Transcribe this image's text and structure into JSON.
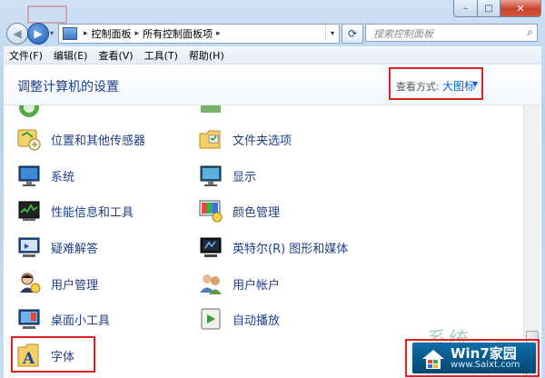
{
  "window": {
    "minimize_glyph": "–",
    "maximize_glyph": "□",
    "close_glyph": "✕"
  },
  "nav": {
    "back_glyph": "◀",
    "forward_glyph": "▶",
    "dropdown_glyph": "▾",
    "refresh_glyph": "⟳",
    "search_glyph": "⌕"
  },
  "address": {
    "sep_glyph": "▸",
    "crumbs": [
      "控制面板",
      "所有控制面板项"
    ]
  },
  "search": {
    "placeholder": "搜索控制面板"
  },
  "menu": [
    "文件(F)",
    "编辑(E)",
    "查看(V)",
    "工具(T)",
    "帮助(H)"
  ],
  "header": {
    "title": "调整计算机的设置",
    "view_by_label": "查看方式:",
    "view_by_value": "大图标",
    "caret": "▼"
  },
  "items": {
    "location_sensors": "位置和其他传感器",
    "folder_options": "文件夹选项",
    "system": "系统",
    "display": "显示",
    "performance": "性能信息和工具",
    "color_management": "颜色管理",
    "troubleshooting": "疑难解答",
    "intel_graphics": "英特尔(R) 图形和媒体",
    "user_management": "用户管理",
    "user_accounts": "用户帐户",
    "desktop_gadgets": "桌面小工具",
    "autoplay": "自动播放",
    "fonts": "字体"
  },
  "logo": {
    "title": "Win7家园",
    "url": "www.Saixt.com"
  },
  "watermark": "系统"
}
